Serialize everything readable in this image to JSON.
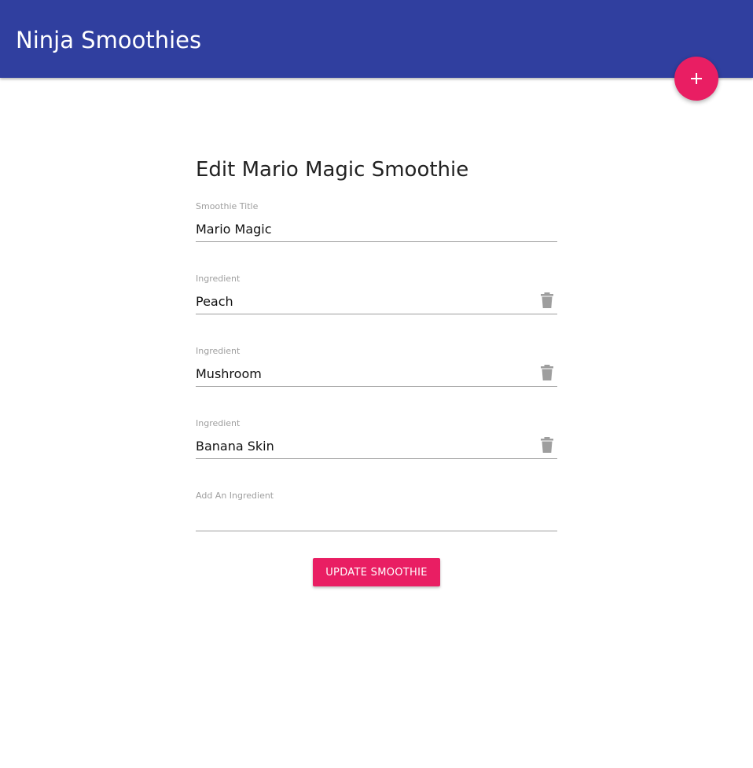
{
  "app": {
    "brand": "Ninja Smoothies",
    "fab_icon": "plus-icon",
    "accent_color": "#e91e63",
    "navbar_color": "#303f9f"
  },
  "form": {
    "title": "Edit Mario Magic Smoothie",
    "title_field": {
      "label": "Smoothie Title",
      "value": "Mario Magic"
    },
    "ingredients": [
      {
        "label": "Ingredient",
        "value": "Peach",
        "delete_icon": "trash-icon"
      },
      {
        "label": "Ingredient",
        "value": "Mushroom",
        "delete_icon": "trash-icon"
      },
      {
        "label": "Ingredient",
        "value": "Banana Skin",
        "delete_icon": "trash-icon"
      }
    ],
    "add_ingredient": {
      "label": "Add An Ingredient",
      "value": ""
    },
    "submit_label": "Update Smoothie"
  }
}
